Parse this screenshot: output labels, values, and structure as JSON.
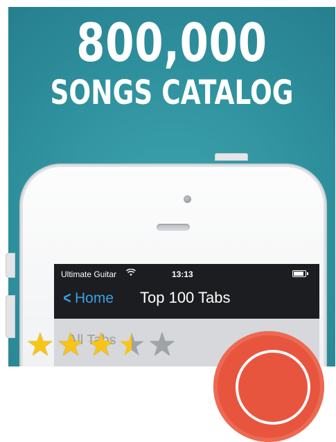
{
  "banner": {
    "headline": "800,000",
    "subheadline": "SONGS CATALOG"
  },
  "phone": {
    "status_bar": {
      "carrier": "Ultimate Guitar",
      "wifi_icon": "wifi-icon",
      "time": "13:13",
      "battery_icon": "battery-icon"
    },
    "nav_bar": {
      "back_label": "Home",
      "title": "Top 100 Tabs"
    },
    "list": {
      "first_item_text": "All Tabs"
    }
  },
  "rating": {
    "value": 3.5,
    "max": 5,
    "star_color": "#f8c515"
  },
  "colors": {
    "background": "#2e8f9c",
    "accent_blue": "#3aa0e6",
    "badge_red": "#e8553f"
  }
}
